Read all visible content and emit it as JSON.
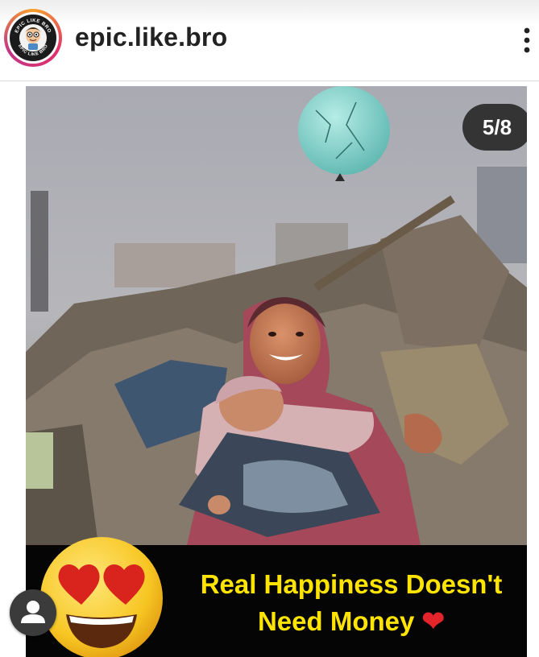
{
  "header": {
    "username": "epic.like.bro",
    "avatar_text_top": "EPIC LIKE BRO",
    "avatar_text_bottom": "EPIC LIKE BRO",
    "more_icon": "more-vertical-icon"
  },
  "post": {
    "counter": "5/8",
    "caption_line1": "Real Happiness Doesn't",
    "caption_line2": "Need Money",
    "caption_heart": "❤",
    "emoji": "heart-eyes-emoji",
    "caption_color": "#ffe400"
  },
  "profile_button": {
    "icon": "person-icon"
  }
}
